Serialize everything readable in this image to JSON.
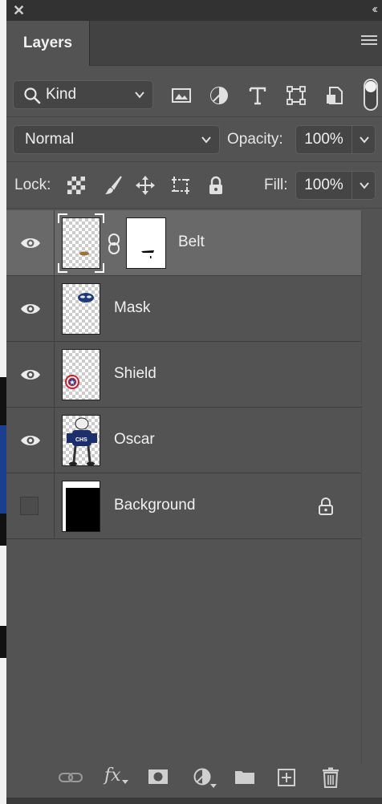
{
  "panel": {
    "tab_label": "Layers"
  },
  "filter": {
    "kind_label": "Kind",
    "icons": [
      "image-filter-icon",
      "adjustment-filter-icon",
      "type-filter-icon",
      "shape-filter-icon",
      "smart-object-filter-icon"
    ]
  },
  "blend": {
    "mode": "Normal",
    "opacity_label": "Opacity:",
    "opacity_value": "100%"
  },
  "lock": {
    "label": "Lock:",
    "fill_label": "Fill:",
    "fill_value": "100%"
  },
  "layers": [
    {
      "name": "Belt",
      "visible": true,
      "selected": true,
      "has_mask": true
    },
    {
      "name": "Mask",
      "visible": true,
      "selected": false
    },
    {
      "name": "Shield",
      "visible": true,
      "selected": false
    },
    {
      "name": "Oscar",
      "visible": true,
      "selected": false
    },
    {
      "name": "Background",
      "visible": false,
      "selected": false,
      "locked": true
    }
  ],
  "footer": {
    "icons": [
      "link-layers-icon",
      "fx-icon",
      "add-mask-icon",
      "adjustment-layer-icon",
      "group-folder-icon",
      "new-layer-icon",
      "delete-icon"
    ],
    "fx_label": "fx"
  },
  "colors": {
    "panel_bg": "#535353",
    "selected_row": "#696969",
    "titlebar": "#323232"
  }
}
